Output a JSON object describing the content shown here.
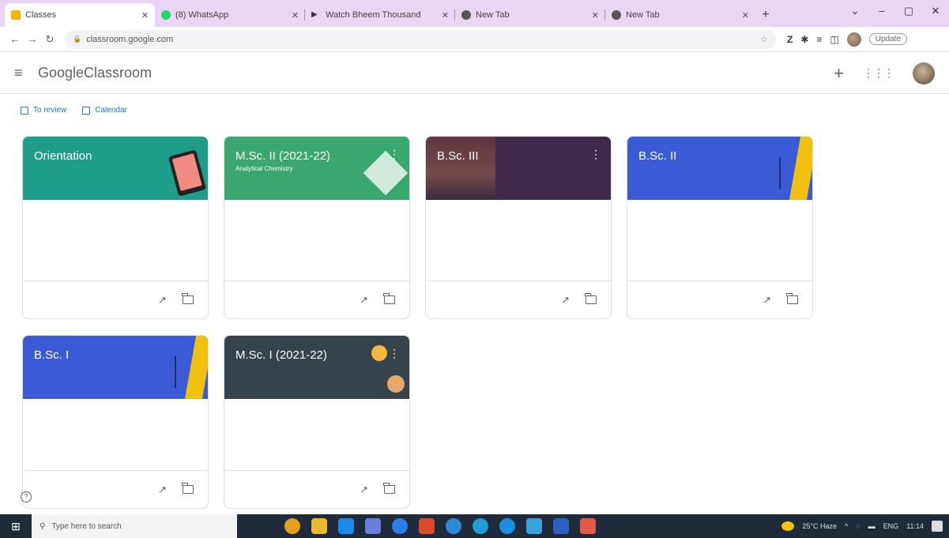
{
  "browser": {
    "tabs": [
      {
        "title": "Classes",
        "favicon_color": "#f4b400",
        "active": true
      },
      {
        "title": "(8) WhatsApp",
        "favicon_color": "#25d366",
        "active": false
      },
      {
        "title": "Watch Bheem Thousand",
        "favicon_color": "#333333",
        "active": false
      },
      {
        "title": "New Tab",
        "favicon_color": "#555555",
        "active": false
      },
      {
        "title": "New Tab",
        "favicon_color": "#555555",
        "active": false
      }
    ],
    "new_tab_symbol": "+",
    "url": "classroom.google.com",
    "update_label": "Update"
  },
  "app": {
    "brand_google": "Google",
    "brand_product": "Classroom"
  },
  "links": {
    "to_review": "To review",
    "calendar": "Calendar"
  },
  "classes": [
    {
      "name": "Orientation",
      "section": "",
      "color": "#1e9e8a"
    },
    {
      "name": "M.Sc. II (2021-22)",
      "section": "Analytical Chemistry",
      "color": "#3aa86e"
    },
    {
      "name": "B.Sc. III",
      "section": "",
      "color": "#3f2a4d"
    },
    {
      "name": "B.Sc. II",
      "section": "",
      "color": "#3a5ad6"
    },
    {
      "name": "B.Sc. I",
      "section": "",
      "color": "#3a5ad6"
    },
    {
      "name": "M.Sc. I (2021-22)",
      "section": "",
      "color": "#36434b"
    }
  ],
  "taskbar": {
    "search_placeholder": "Type here to search",
    "weather": "25°C Haze",
    "lang": "ENG",
    "time": "11:14"
  }
}
